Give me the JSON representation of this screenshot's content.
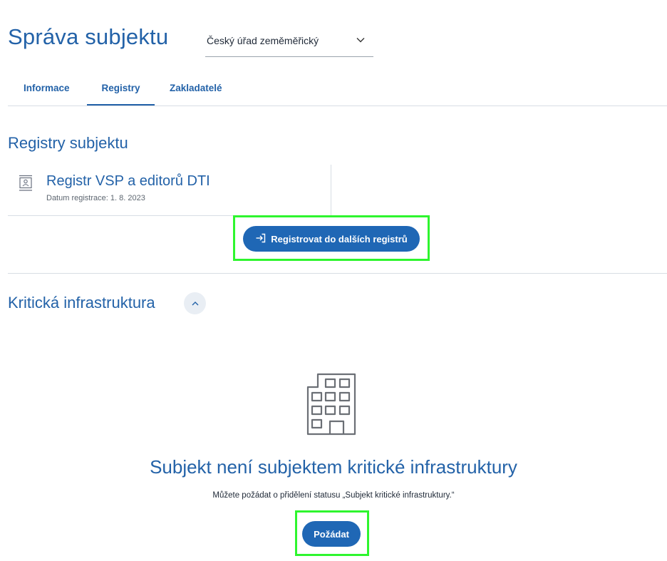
{
  "header": {
    "title": "Správa subjektu",
    "org_select": {
      "value": "Český úřad zeměměřický"
    }
  },
  "tabs": [
    {
      "label": "Informace",
      "active": false
    },
    {
      "label": "Registry",
      "active": true
    },
    {
      "label": "Zakladatelé",
      "active": false
    }
  ],
  "registries": {
    "title": "Registry subjektu",
    "items": [
      {
        "name": "Registr VSP a editorů DTI",
        "date_label": "Datum registrace:",
        "date_value": "1. 8. 2023",
        "icon": "id-card-icon"
      }
    ],
    "register_button_label": "Registrovat do dalších registrů",
    "register_button_icon": "login-arrow-icon"
  },
  "critical_infrastructure": {
    "title": "Kritická infrastruktura",
    "expanded": true,
    "empty_state": {
      "icon": "building-icon",
      "title": "Subjekt není subjektem kritické infrastruktury",
      "description": "Můžete požádat o přidělení statusu „Subjekt kritické infrastruktury.“",
      "button_label": "Požádat"
    }
  },
  "colors": {
    "primary": "#2362a8",
    "button": "#1f67b5",
    "highlight": "#2ef52e",
    "divider": "#d7dde4"
  }
}
